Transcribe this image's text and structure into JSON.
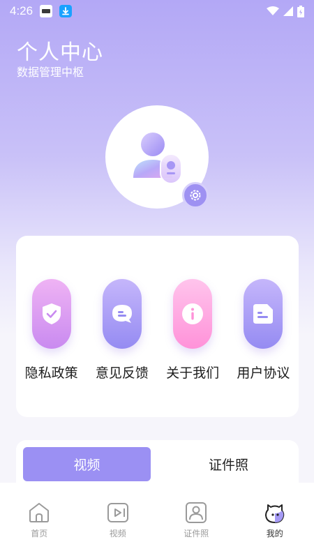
{
  "status_bar": {
    "time": "4:26"
  },
  "header": {
    "title": "个人中心",
    "subtitle": "数据管理中枢"
  },
  "menu": {
    "items": [
      {
        "label": "隐私政策",
        "icon": "shield-check-icon"
      },
      {
        "label": "意见反馈",
        "icon": "chat-bubble-icon"
      },
      {
        "label": "关于我们",
        "icon": "info-icon"
      },
      {
        "label": "用户协议",
        "icon": "document-icon"
      }
    ]
  },
  "tabs": {
    "active_label": "视频",
    "inactive_label": "证件照"
  },
  "bottom_nav": {
    "items": [
      {
        "label": "首页",
        "icon": "home-icon"
      },
      {
        "label": "视频",
        "icon": "video-icon"
      },
      {
        "label": "证件照",
        "icon": "id-photo-icon"
      },
      {
        "label": "我的",
        "icon": "profile-icon"
      }
    ],
    "active_index": 3
  },
  "colors": {
    "accent": "#9b90f3",
    "header_gradient_top": "#b3a8f6",
    "background": "#f6f5fb"
  }
}
